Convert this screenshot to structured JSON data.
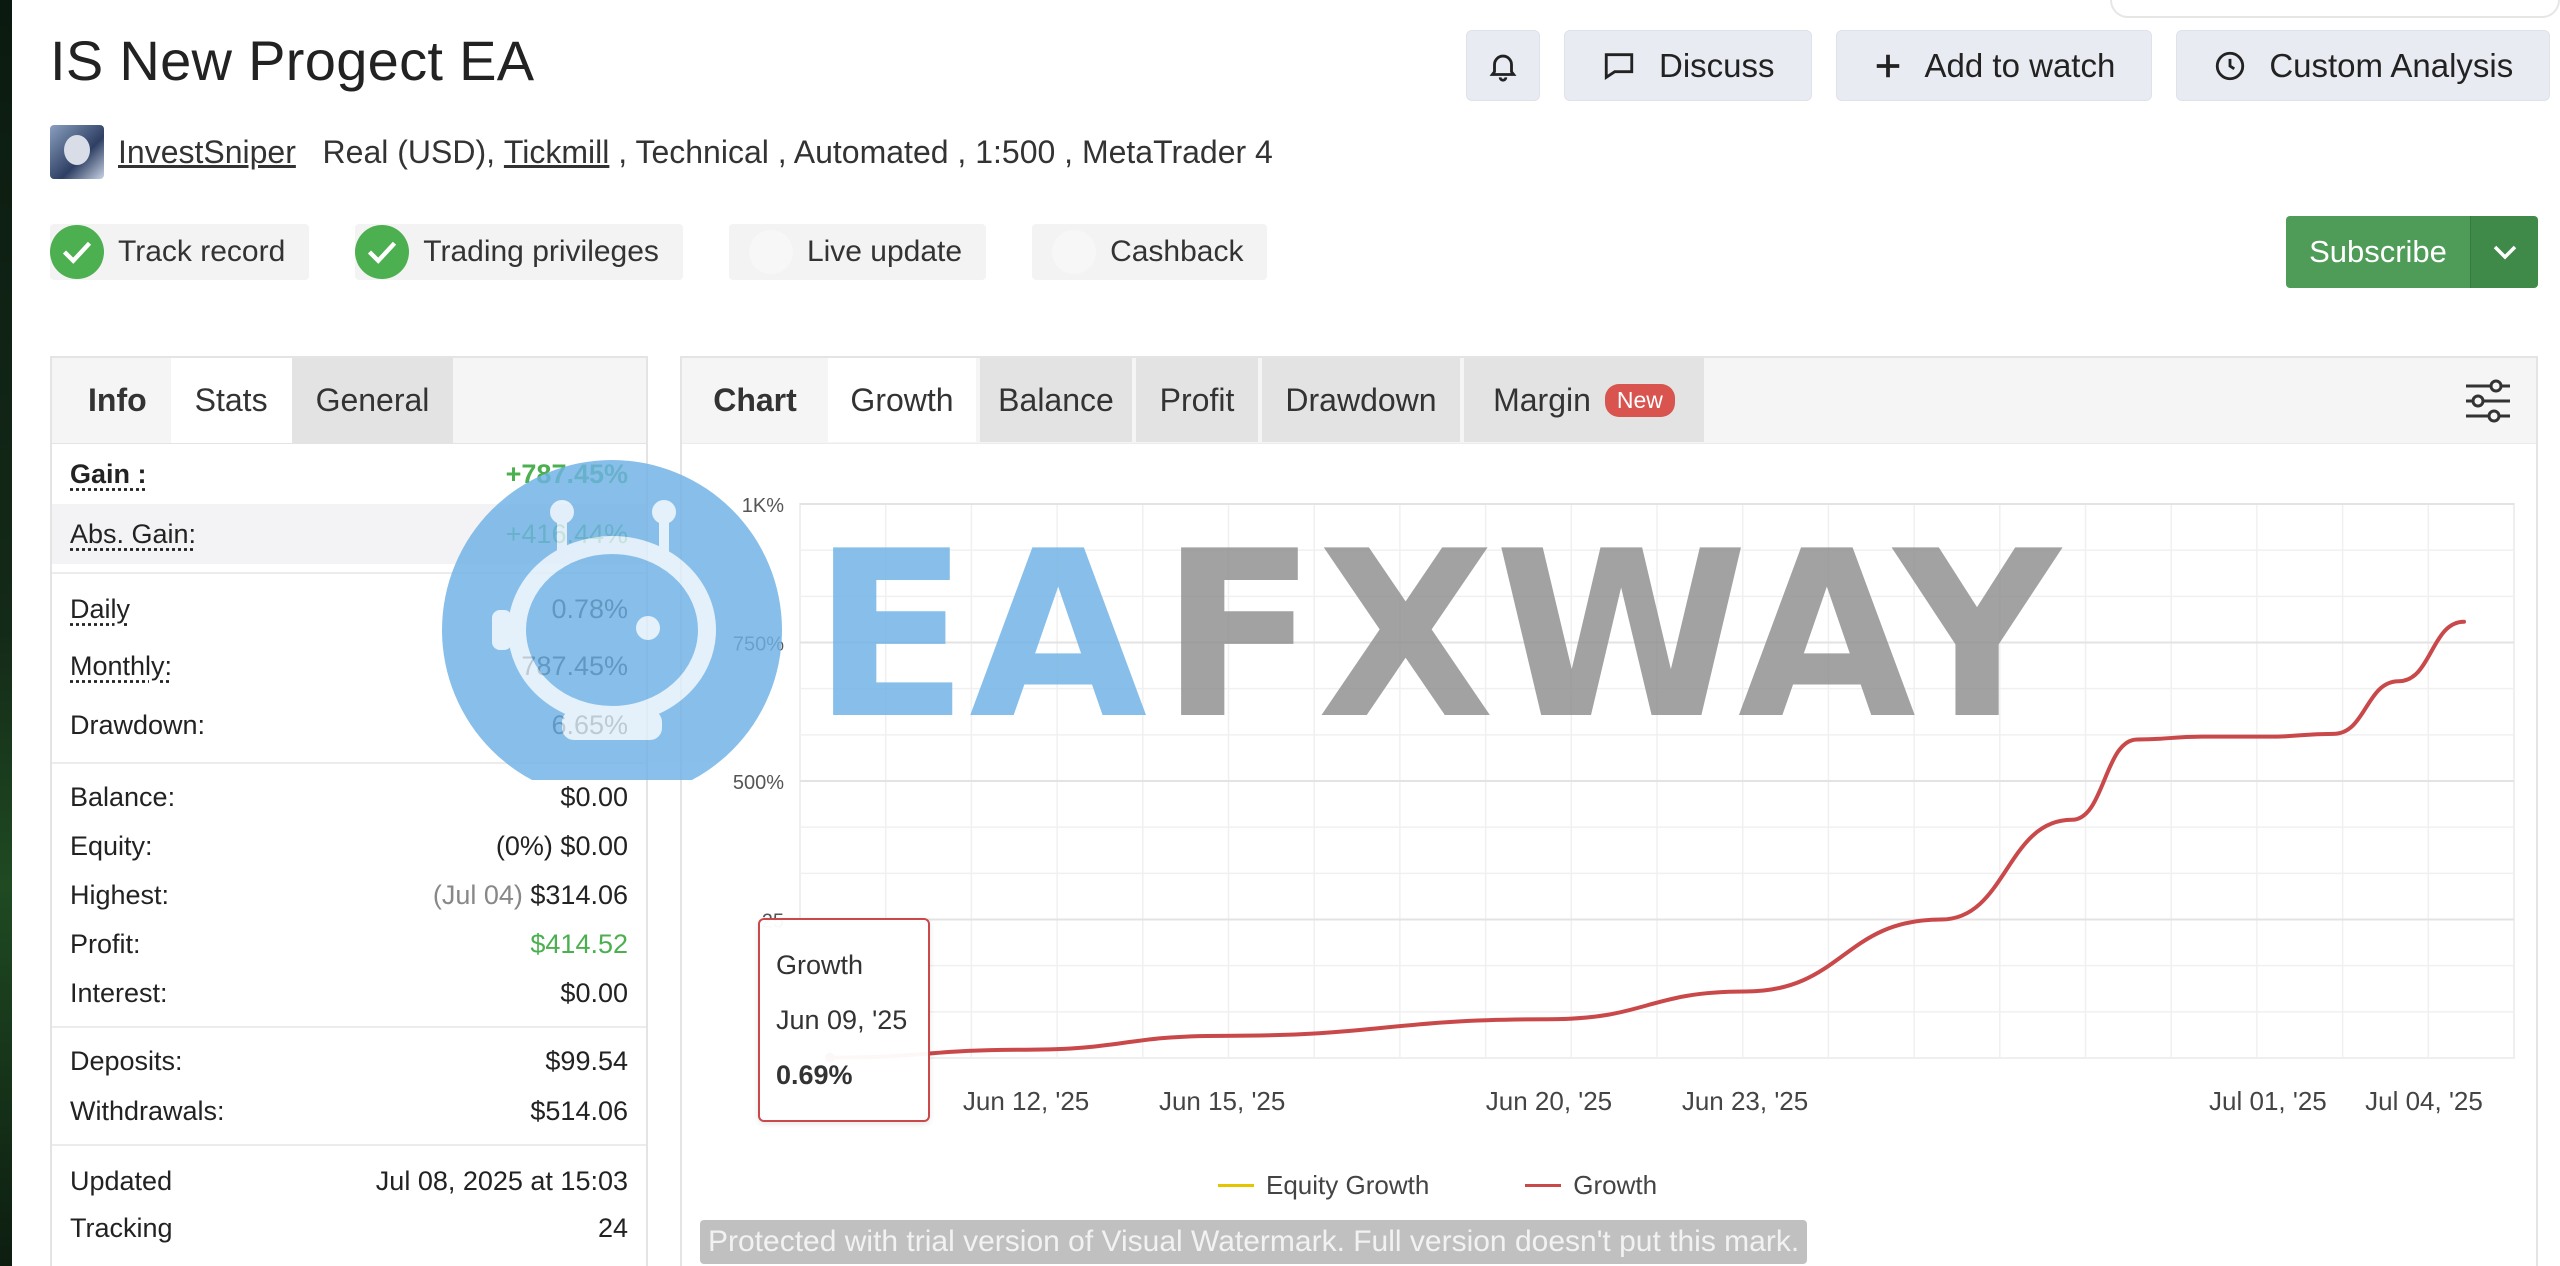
{
  "page": {
    "title": "IS New Progect EA"
  },
  "header": {
    "discuss_label": "Discuss",
    "watch_label": "Add to watch",
    "custom_label": "Custom Analysis"
  },
  "meta": {
    "author": "InvestSniper",
    "account": "Real (USD),",
    "broker": "Tickmill",
    "rest": " , Technical , Automated , 1:500 , MetaTrader 4"
  },
  "badges": {
    "track": "Track record",
    "privileges": "Trading privileges",
    "live": "Live update",
    "cashback": "Cashback"
  },
  "subscribe": {
    "label": "Subscribe"
  },
  "stats": {
    "tabs": {
      "info": "Info",
      "stats": "Stats",
      "general": "General"
    },
    "gain": {
      "label": "Gain :",
      "value": "+787.45%"
    },
    "abs_gain": {
      "label": "Abs. Gain:",
      "value": "+416.44%"
    },
    "daily": {
      "label": "Daily",
      "value": "0.78%"
    },
    "monthly": {
      "label": "Monthly:",
      "value": "787.45%"
    },
    "drawdown": {
      "label": "Drawdown:",
      "value": "6.65%"
    },
    "balance": {
      "label": "Balance:",
      "value": "$0.00"
    },
    "equity": {
      "label": "Equity:",
      "prefix": "(0%)",
      "value": "$0.00"
    },
    "highest": {
      "label": "Highest:",
      "prefix": "(Jul 04)",
      "value": "$314.06"
    },
    "profit": {
      "label": "Profit:",
      "value": "$414.52"
    },
    "interest": {
      "label": "Interest:",
      "value": "$0.00"
    },
    "deposits": {
      "label": "Deposits:",
      "value": "$99.54"
    },
    "withdrawals": {
      "label": "Withdrawals:",
      "value": "$514.06"
    },
    "updated": {
      "label": "Updated",
      "value": "Jul 08, 2025 at 15:03"
    },
    "tracking": {
      "label": "Tracking",
      "value": "24"
    }
  },
  "chart_panel": {
    "tabs": {
      "chart": "Chart",
      "growth": "Growth",
      "balance": "Balance",
      "profit": "Profit",
      "drawdown": "Drawdown",
      "margin": "Margin",
      "new": "New"
    },
    "tooltip": {
      "title": "Growth",
      "date": "Jun 09, '25",
      "value": "0.69%"
    },
    "legend": {
      "equity": "Equity Growth",
      "growth": "Growth"
    },
    "colors": {
      "growth": "#c9484a",
      "equity": "#e5c400"
    }
  },
  "chart_data": {
    "type": "line",
    "x_ticks": [
      "Jun 12, '25",
      "Jun 15, '25",
      "Jun 20, '25",
      "Jun 23, '25",
      "Jul 01, '25",
      "Jul 04, '25"
    ],
    "y_ticks": [
      "1K%",
      "750%",
      "500%",
      "25"
    ],
    "ylim": [
      0,
      1000
    ],
    "series": [
      {
        "name": "Growth",
        "x": [
          "Jun 09, '25",
          "Jun 12, '25",
          "Jun 15, '25",
          "Jun 20, '25",
          "Jun 23, '25",
          "Jun 26, '25",
          "Jun 28, '25",
          "Jun 29, '25",
          "Jun 30, '25",
          "Jul 01, '25",
          "Jul 02, '25",
          "Jul 03, '25",
          "Jul 04, '25"
        ],
        "y": [
          0.69,
          15,
          40,
          70,
          120,
          250,
          430,
          575,
          580,
          580,
          585,
          680,
          787.45
        ]
      },
      {
        "name": "Equity Growth",
        "x": [],
        "y": []
      }
    ],
    "grid": true,
    "legend_position": "bottom"
  },
  "watermarks": {
    "brand_a": "EA",
    "brand_b": "FXWAY",
    "trial": "Protected with trial version of Visual Watermark. Full version doesn't put this mark."
  }
}
